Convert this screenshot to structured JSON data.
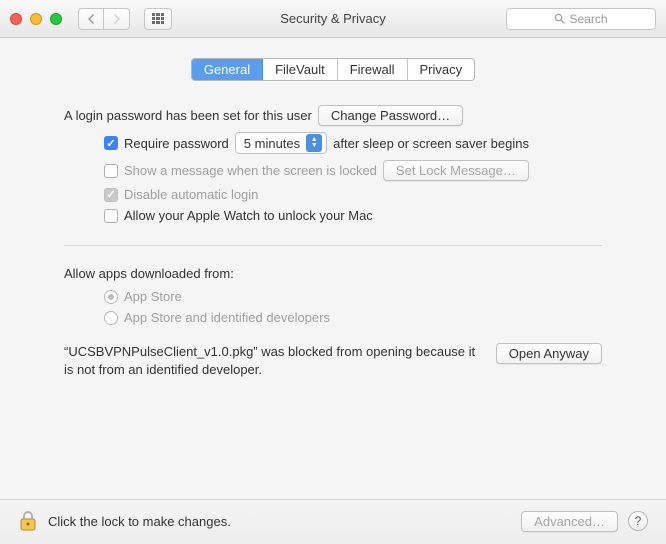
{
  "window": {
    "title": "Security & Privacy",
    "search_placeholder": "Search"
  },
  "tabs": {
    "general": "General",
    "filevault": "FileVault",
    "firewall": "Firewall",
    "privacy": "Privacy",
    "active": "general"
  },
  "login": {
    "password_set_text": "A login password has been set for this user",
    "change_password_btn": "Change Password…",
    "require_password_label": "Require password",
    "require_password_checked": true,
    "delay_options_selected": "5 minutes",
    "after_sleep_text": "after sleep or screen saver begins",
    "show_message_label": "Show a message when the screen is locked",
    "show_message_checked": false,
    "set_lock_message_btn": "Set Lock Message…",
    "disable_auto_login_label": "Disable automatic login",
    "disable_auto_login_checked": true,
    "apple_watch_label": "Allow your Apple Watch to unlock your Mac",
    "apple_watch_checked": false
  },
  "gatekeeper": {
    "heading": "Allow apps downloaded from:",
    "option_appstore": "App Store",
    "option_identified": "App Store and identified developers",
    "selected": "appstore",
    "blocked_message": "“UCSBVPNPulseClient_v1.0.pkg” was blocked from opening because it is not from an identified developer.",
    "open_anyway_btn": "Open Anyway"
  },
  "footer": {
    "lock_text": "Click the lock to make changes.",
    "advanced_btn": "Advanced…",
    "help": "?"
  }
}
